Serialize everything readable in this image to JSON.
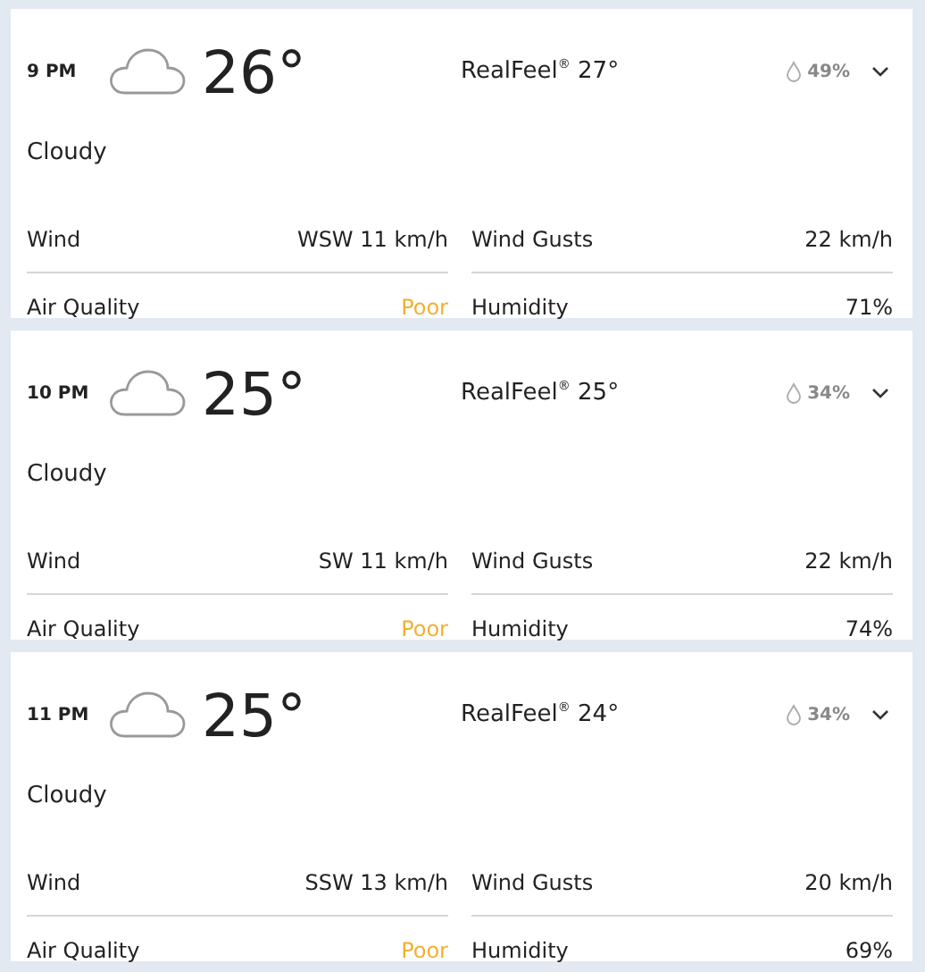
{
  "hours": [
    {
      "time": "9 PM",
      "temp": "26°",
      "realfeel": "RealFeel$^{®}$ 27°",
      "precip": "49%",
      "expanded": false,
      "condition": "Cloudy",
      "details": [
        {
          "label": "Wind",
          "value": "WSW 11 km/h"
        },
        {
          "label": "Wind Gusts",
          "value": "22 km/h"
        },
        {
          "label": "Air Quality",
          "value": "Poor",
          "color": "#f0b030"
        },
        {
          "label": "Humidity",
          "value": "71%"
        }
      ]
    },
    {
      "time": "10 PM",
      "temp": "25°",
      "realfeel": "RealFeel$^{®}$ 25°",
      "precip": "34%",
      "expanded": false,
      "condition": "Cloudy",
      "details": [
        {
          "label": "Wind",
          "value": "SW 11 km/h"
        },
        {
          "label": "Wind Gusts",
          "value": "22 km/h"
        },
        {
          "label": "Air Quality",
          "value": "Poor",
          "color": "#f0b030"
        },
        {
          "label": "Humidity",
          "value": "74%"
        }
      ]
    },
    {
      "time": "11 PM",
      "temp": "25°",
      "realfeel": "RealFeel$^{®}$ 24°",
      "precip": "34%",
      "expanded": false,
      "condition": "Cloudy",
      "details": [
        {
          "label": "Wind",
          "value": "SSW 13 km/h"
        },
        {
          "label": "Wind Gusts",
          "value": "20 km/h"
        },
        {
          "label": "Air Quality",
          "value": "Poor",
          "color": "#f0b030"
        },
        {
          "label": "Humidity",
          "value": "69%"
        }
      ]
    }
  ]
}
